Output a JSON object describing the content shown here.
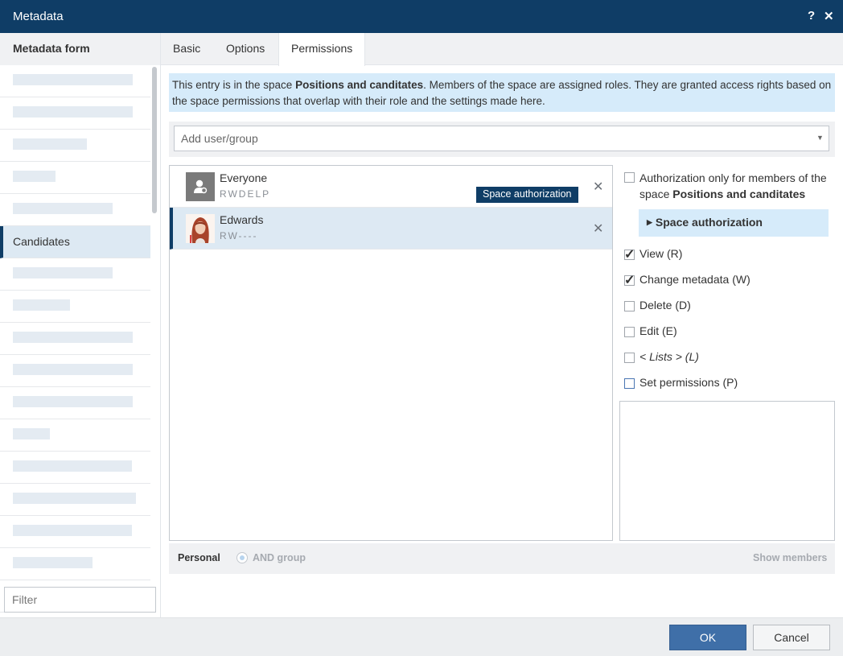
{
  "window": {
    "title": "Metadata",
    "help_icon": "?",
    "close_icon": "✕"
  },
  "sidebar": {
    "header": "Metadata form",
    "active_field": "Candidates",
    "filter_placeholder": "Filter"
  },
  "tabs": {
    "basic": "Basic",
    "options": "Options",
    "permissions": "Permissions"
  },
  "info": {
    "text_before": "This entry is in the space ",
    "space_name": "Positions and canditates",
    "text_after": ". Members of the space are assigned roles. They are granted access rights based on the space permissions that overlap with their role and the settings made here."
  },
  "add_user": {
    "placeholder": "Add user/group"
  },
  "users": [
    {
      "name": "Everyone",
      "perms": "RWDELP",
      "badge": "Space authorization",
      "icon": "group-icon"
    },
    {
      "name": "Edwards",
      "perms": "RW----",
      "icon": "user-photo"
    }
  ],
  "permissions": {
    "auth_only_text": "Authorization only for members of the space ",
    "auth_only_space": "Positions and canditates",
    "space_auth_header": "Space authorization",
    "items": {
      "view": {
        "label": "View (R)",
        "checked": true
      },
      "change": {
        "label": "Change metadata (W)",
        "checked": true
      },
      "delete": {
        "label": "Delete (D)",
        "checked": false
      },
      "edit": {
        "label": "Edit (E)",
        "checked": false
      },
      "lists_name": "< Lists >",
      "lists_suffix": " (L)",
      "lists_checked": false,
      "set": {
        "label": "Set permissions (P)",
        "checked": false
      }
    }
  },
  "footer_strip": {
    "personal": "Personal",
    "and_group": "AND group",
    "show_members": "Show members"
  },
  "buttons": {
    "ok": "OK",
    "cancel": "Cancel"
  },
  "colors": {
    "titlebar": "#0f3d66",
    "accent": "#0f3d66",
    "info_bg": "#d6ebfa",
    "selected_row": "#dde9f3",
    "ok_button": "#3f6fa8"
  }
}
